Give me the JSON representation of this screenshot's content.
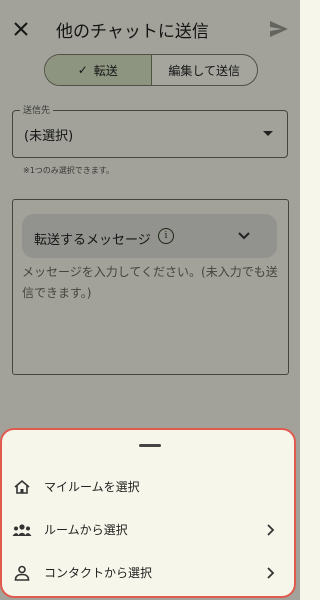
{
  "header": {
    "title": "他のチャットに送信"
  },
  "mode_tabs": [
    {
      "label": "転送",
      "selected": true
    },
    {
      "label": "編集して送信",
      "selected": false
    }
  ],
  "destination": {
    "label": "送信先",
    "value": "(未選択)",
    "helper": "※1つのみ選択できます。"
  },
  "message": {
    "forward_header": "転送するメッセージ",
    "placeholder": "メッセージを入力してください。(未入力でも送信できます。)"
  },
  "sheet": {
    "items": [
      {
        "label": "マイルームを選択",
        "icon": "home-icon",
        "has_arrow": false
      },
      {
        "label": "ルームから選択",
        "icon": "group-icon",
        "has_arrow": true
      },
      {
        "label": "コンタクトから選択",
        "icon": "person-icon",
        "has_arrow": true
      }
    ],
    "accent_border": "#e05a4e"
  }
}
